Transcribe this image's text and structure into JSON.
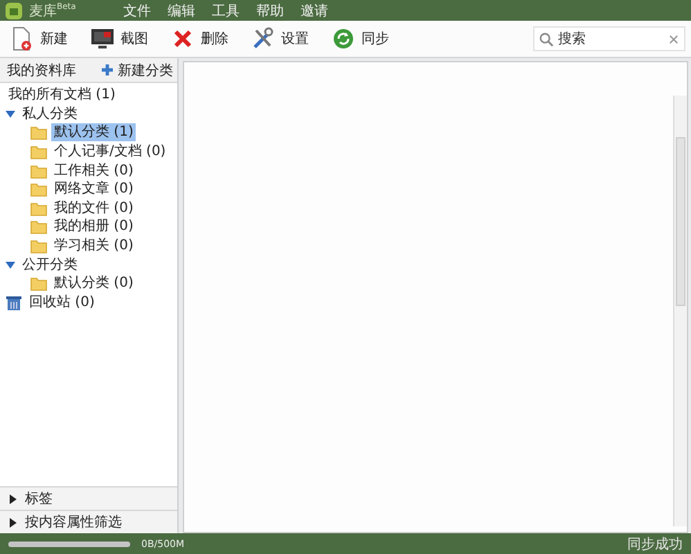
{
  "window": {
    "title": "麦库",
    "title_badge": "Beta"
  },
  "menu": [
    "文件",
    "编辑",
    "工具",
    "帮助",
    "邀请"
  ],
  "toolbar": [
    {
      "kind": "new",
      "label": "新建"
    },
    {
      "kind": "capture",
      "label": "截图"
    },
    {
      "kind": "delete",
      "label": "删除"
    },
    {
      "kind": "settings",
      "label": "设置"
    },
    {
      "kind": "sync",
      "label": "同步"
    }
  ],
  "search": {
    "placeholder": "搜索"
  },
  "sidebar": {
    "title": "我的资料库",
    "new_category": "新建分类",
    "tree": [
      {
        "kind": "all",
        "label": "我的所有文档 (1)"
      },
      {
        "kind": "group",
        "label": "私人分类",
        "expanded": true,
        "children": [
          {
            "kind": "folder",
            "label": "默认分类 (1)",
            "selected": true
          },
          {
            "kind": "folder",
            "label": "个人记事/文档 (0)",
            "selected": false
          },
          {
            "kind": "folder",
            "label": "工作相关 (0)",
            "selected": false
          },
          {
            "kind": "folder",
            "label": "网络文章 (0)",
            "selected": false
          },
          {
            "kind": "folder",
            "label": "我的文件 (0)",
            "selected": false
          },
          {
            "kind": "folder",
            "label": "我的相册 (0)",
            "selected": false
          },
          {
            "kind": "folder",
            "label": "学习相关 (0)",
            "selected": false
          }
        ]
      },
      {
        "kind": "group",
        "label": "公开分类",
        "expanded": true,
        "children": [
          {
            "kind": "folder",
            "label": "默认分类 (0)",
            "selected": false
          }
        ]
      },
      {
        "kind": "trash",
        "label": "回收站 (0)"
      }
    ],
    "panels": [
      {
        "label": "标签",
        "expanded": false
      },
      {
        "label": "按内容属性筛选",
        "expanded": false
      }
    ]
  },
  "status_bar": {
    "usage": "0B/500M",
    "message": "同步成功"
  }
}
